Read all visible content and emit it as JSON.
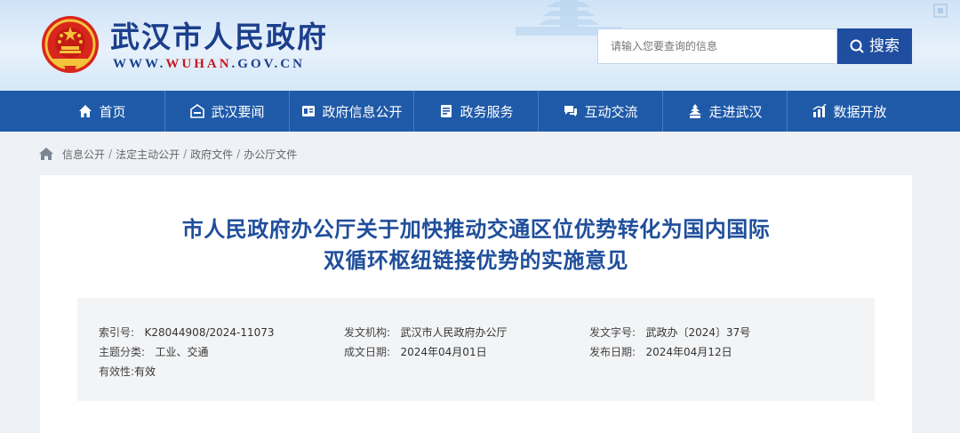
{
  "header": {
    "site_title": "武汉市人民政府",
    "site_url_prefix": "WWW.",
    "site_url_highlight": "WUHAN",
    "site_url_suffix": ".GOV.CN",
    "search_placeholder": "请输入您要查询的信息",
    "search_button": "搜索",
    "colors": {
      "brand_blue": "#1c3f8c",
      "accent_red": "#c8161d",
      "nav_bg": "#1f5aa8"
    }
  },
  "nav": {
    "items": [
      {
        "label": "首页",
        "icon": "home-icon"
      },
      {
        "label": "武汉要闻",
        "icon": "news-icon"
      },
      {
        "label": "政府信息公开",
        "icon": "info-disclosure-icon"
      },
      {
        "label": "政务服务",
        "icon": "service-icon"
      },
      {
        "label": "互动交流",
        "icon": "interaction-icon"
      },
      {
        "label": "走进武汉",
        "icon": "city-icon"
      },
      {
        "label": "数据开放",
        "icon": "data-chart-icon"
      }
    ]
  },
  "breadcrumb": {
    "items": [
      "信息公开",
      "法定主动公开",
      "政府文件",
      "办公厅文件"
    ],
    "separator": "/"
  },
  "document": {
    "title_line1": "市人民政府办公厅关于加快推动交通区位优势转化为国内国际",
    "title_line2": "双循环枢纽链接优势的实施意见",
    "meta": {
      "index_label": "索引号:",
      "index_value": "K28044908/2024-11073",
      "issuer_label": "发文机构:",
      "issuer_value": "武汉市人民政府办公厅",
      "docno_label": "发文字号:",
      "docno_value": "武政办〔2024〕37号",
      "topic_label": "主题分类:",
      "topic_value": "工业、交通",
      "created_label": "成文日期:",
      "created_value": "2024年04月01日",
      "published_label": "发布日期:",
      "published_value": "2024年04月12日",
      "validity_label": "有效性:",
      "validity_value": "有效"
    }
  }
}
